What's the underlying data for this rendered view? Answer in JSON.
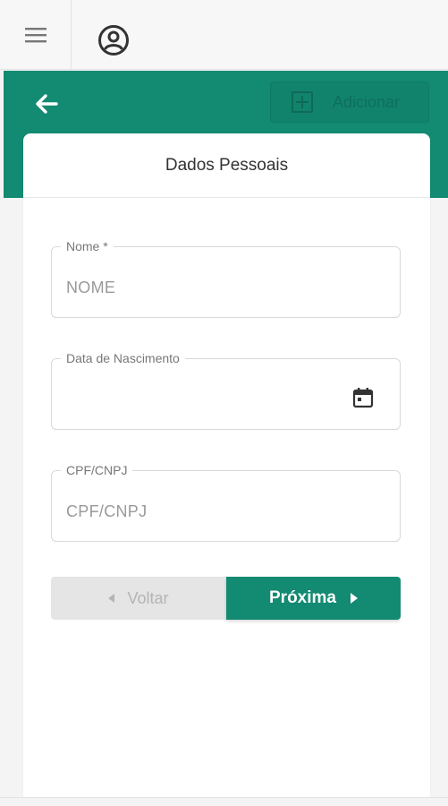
{
  "topbar": {
    "menu_icon": "hamburger-icon",
    "user_icon": "user-circle-icon"
  },
  "header": {
    "back_icon": "arrow-left-icon",
    "add_label": "Adicionar",
    "add_icon": "plus-square-icon"
  },
  "card": {
    "title": "Dados Pessoais"
  },
  "form": {
    "name": {
      "label": "Nome *",
      "placeholder": "NOME",
      "value": ""
    },
    "birth_date": {
      "label": "Data de Nascimento",
      "value": "",
      "icon": "calendar-icon"
    },
    "document": {
      "label": "CPF/CNPJ",
      "placeholder": "CPF/CNPJ",
      "value": ""
    }
  },
  "nav": {
    "prev_label": "Voltar",
    "next_label": "Próxima"
  },
  "colors": {
    "primary": "#138a72",
    "disabled_bg": "#e5e5e5"
  }
}
